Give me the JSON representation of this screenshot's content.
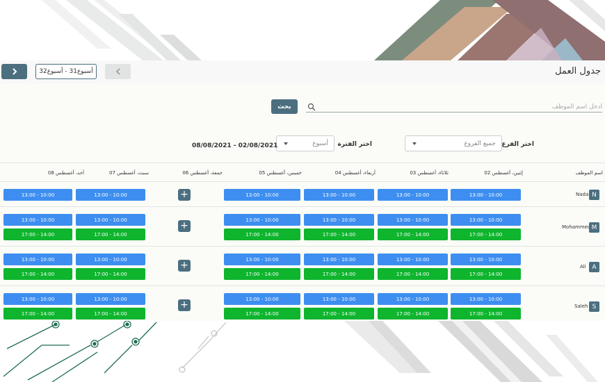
{
  "header": {
    "title": "جدول العمل",
    "week_label": "أسبوع31 - أسبوع32"
  },
  "search": {
    "placeholder": "أدخل اسم الموظف",
    "button_label": "بحث"
  },
  "filters": {
    "branch_label": "اختر الفرع",
    "branch_value": "جميع الفروع",
    "period_label": "اختر الفترة",
    "period_value": "أسبوع",
    "date_range": "08/08/2021 - 02/08/2021"
  },
  "columns": {
    "employee": "اسم الموظف",
    "days": [
      "إثنين، أغسطس 02",
      "ثلاثاء، أغسطس 03",
      "أربعاء، أغسطس 04",
      "خميس، أغسطس 05",
      "جمعة، أغسطس 06",
      "سبت، أغسطس 07",
      "أحد، أغسطس 08"
    ]
  },
  "shift_labels": {
    "morning": "13:00 - 10:00",
    "evening": "17:00 - 14:00"
  },
  "add_label": "+",
  "colors": {
    "primary": "#4c6f80",
    "morning": "#3d8ef0",
    "evening": "#0eb52d"
  },
  "employees": [
    {
      "name": "Nada",
      "initial": "N"
    },
    {
      "name": "Mohammed",
      "initial": "M"
    },
    {
      "name": "Ali",
      "initial": "A"
    },
    {
      "name": "Saleh",
      "initial": "S"
    }
  ]
}
